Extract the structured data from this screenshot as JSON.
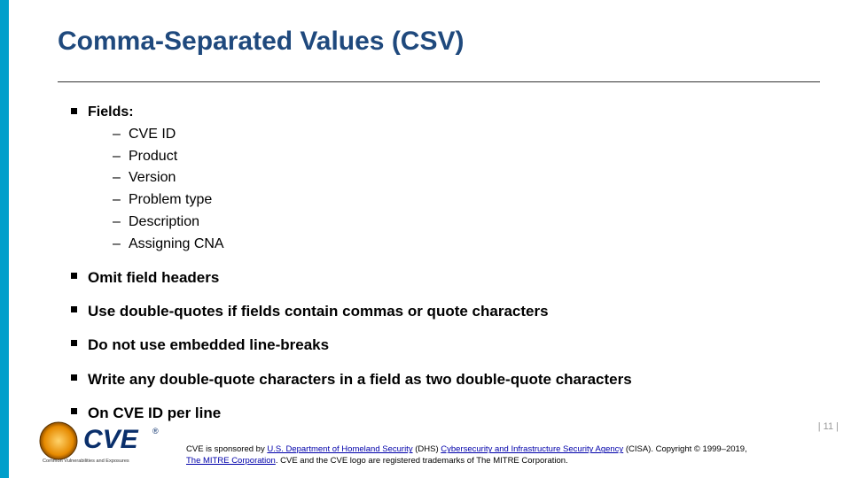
{
  "title": "Comma-Separated Values (CSV)",
  "fields_label": "Fields:",
  "fields": {
    "i0": "CVE ID",
    "i1": "Product",
    "i2": "Version",
    "i3": "Problem type",
    "i4": "Description",
    "i5": "Assigning CNA"
  },
  "bullets": {
    "b1": "Omit field headers",
    "b2": "Use double-quotes if fields contain commas or quote characters",
    "b3": "Do not use embedded line-breaks",
    "b4": "Write any double-quote characters in a field as two double-quote characters",
    "b5": "On CVE ID per line"
  },
  "footer": {
    "pagenum": "| 11 |",
    "sponsored_prefix": "CVE is sponsored by ",
    "dhs_link": "U.S. Department of Homeland Security",
    "dhs_abbrev": " (DHS) ",
    "cisa_link": "Cybersecurity and Infrastructure Security Agency",
    "cisa_suffix": " (CISA). Copyright © 1999–2019, ",
    "mitre_link": "The MITRE Corporation",
    "trademark": ". CVE and the CVE logo are registered trademarks of The MITRE Corporation.",
    "logo_text": "CVE",
    "logo_tagline": "Common Vulnerabilities and Exposures"
  }
}
